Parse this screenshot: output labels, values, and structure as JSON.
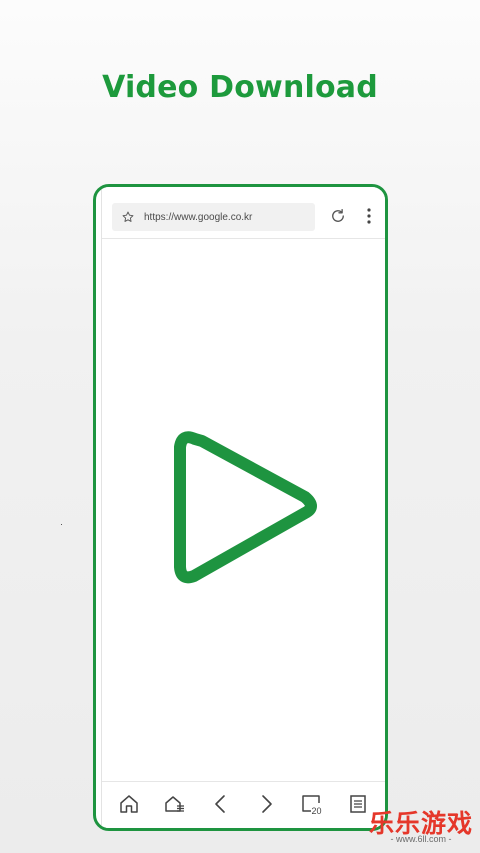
{
  "headline": "Video Download",
  "browser": {
    "url": "https://www.google.co.kr"
  },
  "icons": {
    "bookmark": "star-outline-icon",
    "reload": "refresh-icon",
    "menu": "vertical-dots-icon",
    "content": "play-icon",
    "home": "home-icon",
    "home_list": "home-list-icon",
    "back": "chevron-left-icon",
    "forward": "chevron-right-icon",
    "tabs": "tabs-icon",
    "list": "list-icon"
  },
  "bottom_nav": {
    "tabs_count": "20"
  },
  "watermark": {
    "title": "乐乐游戏",
    "url": "- www.6ll.com -"
  },
  "colors": {
    "brand_green": "#1d9a3c",
    "frame_green": "#1e9440",
    "watermark_red": "#e5372a"
  }
}
